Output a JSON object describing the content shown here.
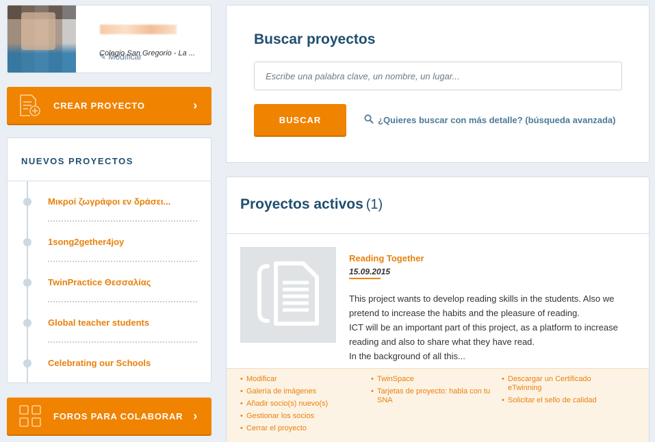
{
  "profile": {
    "school": "Colegio San Gregorio - La ...",
    "modify_label": "Modificar"
  },
  "create_project": {
    "label": "CREAR PROYECTO",
    "chevron": "›"
  },
  "new_projects": {
    "title": "NUEVOS PROYECTOS",
    "items": [
      {
        "label": "Μικροί ζωγράφοι εν δράσει..."
      },
      {
        "label": "1song2gether4joy"
      },
      {
        "label": "TwinPractice Θεσσαλίας"
      },
      {
        "label": "Global teacher students"
      },
      {
        "label": "Celebrating our Schools"
      }
    ]
  },
  "forums": {
    "label": "FOROS PARA COLABORAR",
    "chevron": "›"
  },
  "search": {
    "title": "Buscar proyectos",
    "placeholder": "Escribe una palabra clave, un nombre, un lugar...",
    "button_label": "BUSCAR",
    "advanced_label": "¿Quieres buscar con más detalle? (búsqueda avanzada)"
  },
  "active_projects": {
    "title": "Proyectos activos",
    "count": "(1)",
    "project": {
      "title": "Reading Together",
      "date": "15.09.2015",
      "description": [
        "This project wants to develop reading skills in the students. Also we pretend to increase the habits and the pleasure of reading.",
        "ICT will be an important part of this project, as a platform to increase reading and also to share what they have read.",
        "In the background of all this..."
      ]
    },
    "actions": {
      "col1": [
        "Modificar",
        "Galería de imágenes",
        "Añadir socio(s) nuevo(s)",
        "Gestionar los socios",
        "Cerrar el proyecto"
      ],
      "col2": [
        "TwinSpace",
        "Tarjetas de proyecto: habla con tu SNA"
      ],
      "col3": [
        "Descargar un Certificado eTwinning",
        "Solicitar el sello de calidad"
      ]
    }
  },
  "colors": {
    "accent_orange": "#f08300",
    "heading_blue": "#1f4e70",
    "link_blue": "#4f7a98",
    "background": "#e9eff4"
  }
}
